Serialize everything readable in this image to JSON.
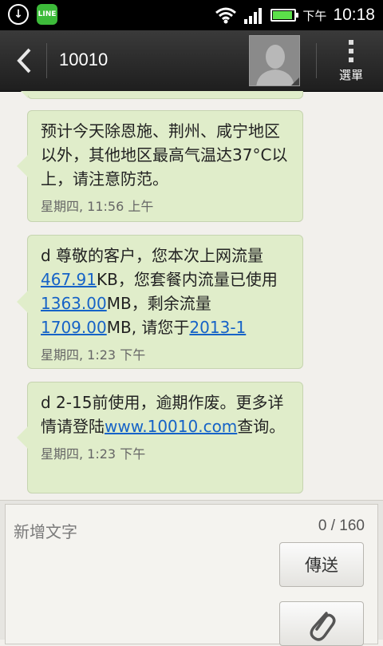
{
  "status_bar": {
    "ampm": "下午",
    "time": "10:18",
    "battery_level": 0.9,
    "icons": [
      "download-icon",
      "line-app-icon",
      "wifi-icon",
      "signal-icon",
      "battery-icon"
    ],
    "line_label": "LINE"
  },
  "header": {
    "title": "10010",
    "menu_label": "選單"
  },
  "messages": [
    {
      "segments": [
        {
          "text": "预计今天除恩施、荆州、咸宁地区以外，其他地区最高气温达37°C以上，请注意防范。"
        }
      ],
      "time": "星期四, 11:56 上午"
    },
    {
      "segments": [
        {
          "text": "d  尊敬的客户，您本次上网流量"
        },
        {
          "text": "467.91",
          "link": true
        },
        {
          "text": "KB，您套餐内流量已使用"
        },
        {
          "text": "1363.00",
          "link": true
        },
        {
          "text": "MB，剩余流量"
        },
        {
          "text": "1709.00",
          "link": true
        },
        {
          "text": "MB, 请您于"
        },
        {
          "text": "2013-1",
          "link": true
        }
      ],
      "time": "星期四, 1:23 下午"
    },
    {
      "segments": [
        {
          "text": "d  2-15前使用，逾期作废。更多详情请登陆"
        },
        {
          "text": "www.10010.com",
          "link": true
        },
        {
          "text": "查询。"
        }
      ],
      "time": "星期四, 1:23 下午"
    }
  ],
  "compose": {
    "placeholder": "新增文字",
    "char_count": "0 / 160",
    "send_label": "傳送"
  },
  "colors": {
    "bubble": "#e0edca",
    "link": "#1663c7",
    "header": "#2a2a2a"
  }
}
